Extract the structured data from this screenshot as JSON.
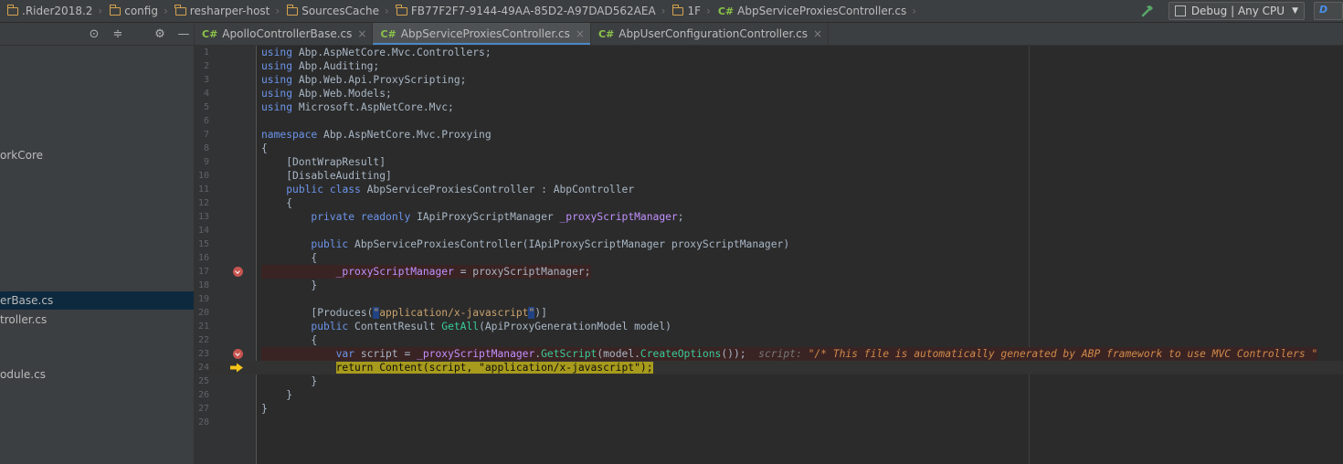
{
  "breadcrumb": [
    {
      "label": ".Rider2018.2",
      "icon": "folder-icon"
    },
    {
      "label": "config",
      "icon": "folder-icon"
    },
    {
      "label": "resharper-host",
      "icon": "folder-icon"
    },
    {
      "label": "SourcesCache",
      "icon": "folder-icon"
    },
    {
      "label": "FB77F2F7-9144-49AA-85D2-A97DAD562AEA",
      "icon": "folder-icon"
    },
    {
      "label": "1F",
      "icon": "folder-icon"
    },
    {
      "label": "AbpServiceProxiesController.cs",
      "icon": "csharp-file-icon",
      "badge": "C#"
    }
  ],
  "toolbar": {
    "config_label": "Debug | Any CPU",
    "run_config_label": "D"
  },
  "left_panel": {
    "items": [
      {
        "label": "orkCore"
      },
      {
        "label": "erBase.cs",
        "selected": true
      },
      {
        "label": "troller.cs"
      },
      {
        "label": "odule.cs"
      }
    ]
  },
  "tabs": [
    {
      "label": "ApolloControllerBase.cs",
      "badge": "C#",
      "active": false
    },
    {
      "label": "AbpServiceProxiesController.cs",
      "badge": "C#",
      "active": true
    },
    {
      "label": "AbpUserConfigurationController.cs",
      "badge": "C#",
      "active": false
    }
  ],
  "tab_close_glyph": "×",
  "editor": {
    "line_numbers": [
      "1",
      "2",
      "3",
      "4",
      "5",
      "6",
      "7",
      "8",
      "9",
      "10",
      "11",
      "12",
      "13",
      "14",
      "15",
      "16",
      "17",
      "18",
      "19",
      "20",
      "21",
      "22",
      "23",
      "24",
      "25",
      "26",
      "27",
      "28"
    ],
    "inline_debug": {
      "name": "script:",
      "value": "\"/* This file is automatically generated by ABP framework to use MVC Controllers \""
    },
    "breakpoint_lines": [
      17,
      23
    ],
    "execution_line": 24
  },
  "colors": {
    "keyword": "#cc7832",
    "keyword_blue": "#6c95eb",
    "field": "#c191ff",
    "string": "#c9a26d",
    "method": "#39cc9b",
    "breakpoint": "#c75450",
    "execution_highlight": "#a79a1c",
    "tab_underline": "#4a88c7"
  }
}
